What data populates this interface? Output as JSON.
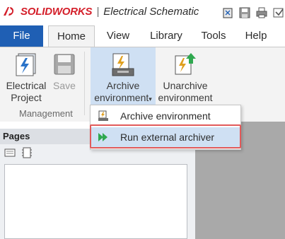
{
  "app": {
    "brand": "SOLIDWORKS",
    "product": "Electrical Schematic"
  },
  "tabs": [
    {
      "label": "File"
    },
    {
      "label": "Home"
    },
    {
      "label": "View"
    },
    {
      "label": "Library"
    },
    {
      "label": "Tools"
    },
    {
      "label": "Help"
    }
  ],
  "ribbon": {
    "electrical_project": {
      "line1": "Electrical",
      "line2": "Project"
    },
    "save": {
      "line1": "Save"
    },
    "group_management": "Management",
    "archive_env": {
      "line1": "Archive",
      "line2": "environment"
    },
    "unarchive_env": {
      "line1": "Unarchive",
      "line2": "environment"
    }
  },
  "dropdown": {
    "items": [
      {
        "label": "Archive environment"
      },
      {
        "label": "Run external archiver"
      }
    ]
  },
  "pages_panel": {
    "title": "Pages"
  },
  "colors": {
    "file_tab": "#1f5fb4",
    "brand_red": "#d41f2a",
    "highlight_border": "#e15a5a",
    "selected_bg": "#cfe0f3"
  }
}
